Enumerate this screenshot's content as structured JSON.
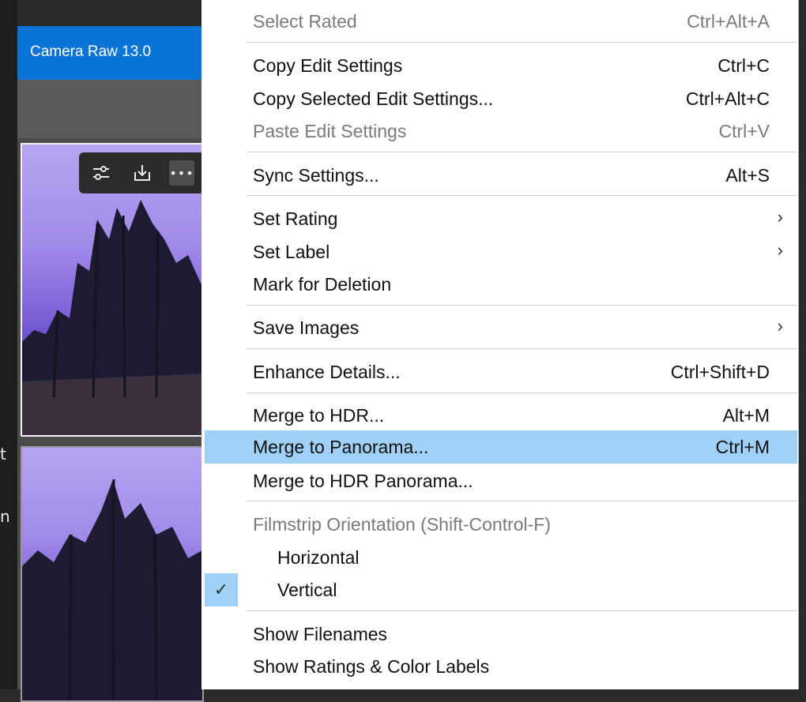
{
  "window": {
    "title": "Camera Raw 13.0"
  },
  "context_menu": {
    "items": [
      {
        "label": "Select Rated",
        "shortcut": "Ctrl+Alt+A"
      },
      {
        "label": "Copy Edit Settings",
        "shortcut": "Ctrl+C"
      },
      {
        "label": "Copy Selected Edit Settings...",
        "shortcut": "Ctrl+Alt+C"
      },
      {
        "label": "Paste Edit Settings",
        "shortcut": "Ctrl+V"
      },
      {
        "label": "Sync Settings...",
        "shortcut": "Alt+S"
      },
      {
        "label": "Set Rating",
        "shortcut": ""
      },
      {
        "label": "Set Label",
        "shortcut": ""
      },
      {
        "label": "Mark for Deletion",
        "shortcut": ""
      },
      {
        "label": "Save Images",
        "shortcut": ""
      },
      {
        "label": "Enhance Details...",
        "shortcut": "Ctrl+Shift+D"
      },
      {
        "label": "Merge to HDR...",
        "shortcut": "Alt+M"
      },
      {
        "label": "Merge to Panorama...",
        "shortcut": "Ctrl+M"
      },
      {
        "label": "Merge to HDR Panorama...",
        "shortcut": ""
      },
      {
        "label": "Filmstrip Orientation (Shift-Control-F)",
        "shortcut": ""
      },
      {
        "label": "Horizontal",
        "shortcut": ""
      },
      {
        "label": "Vertical",
        "shortcut": ""
      },
      {
        "label": "Show Filenames",
        "shortcut": ""
      },
      {
        "label": "Show Ratings & Color Labels",
        "shortcut": ""
      }
    ],
    "submenu_glyph": "›",
    "check_glyph": "✓"
  },
  "thumbnail_toolbar": {
    "icons": [
      "sliders-icon",
      "save-icon",
      "more-options-icon"
    ],
    "more_glyph": "•••"
  },
  "edge_glyphs": {
    "a": "t",
    "b": "n"
  },
  "colors": {
    "title_bar": "#0a74d6",
    "highlight": "#9fd0f6"
  }
}
